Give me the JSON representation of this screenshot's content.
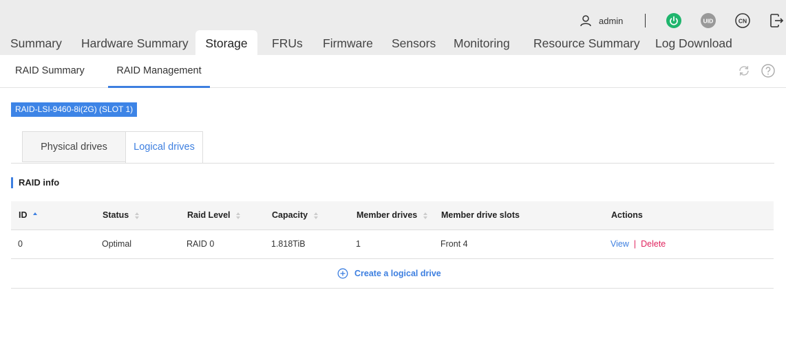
{
  "header": {
    "username": "admin",
    "icons": [
      "user-icon",
      "power-icon",
      "uid-icon",
      "language-icon",
      "logout-icon"
    ],
    "uid_label": "UID",
    "language_label": "CN",
    "colors": {
      "power": "#1fb56d",
      "uid": "#999999"
    }
  },
  "main_tabs": [
    {
      "label": "Summary"
    },
    {
      "label": "Hardware Summary"
    },
    {
      "label": "Storage"
    },
    {
      "label": "FRUs"
    },
    {
      "label": "Firmware"
    },
    {
      "label": "Sensors"
    },
    {
      "label": "Monitoring"
    },
    {
      "label": "Resource Summary"
    },
    {
      "label": "Log Download"
    }
  ],
  "active_main_tab": "Storage",
  "sub_tabs": [
    {
      "label": "RAID Summary"
    },
    {
      "label": "RAID Management"
    }
  ],
  "active_sub_tab": "RAID Management",
  "panel_icons": [
    "refresh-icon",
    "help-icon"
  ],
  "controller": {
    "label": "RAID-LSI-9460-8i(2G) (SLOT 1)"
  },
  "drive_tabs": [
    {
      "label": "Physical drives"
    },
    {
      "label": "Logical drives"
    }
  ],
  "active_drive_tab": "Logical drives",
  "section": {
    "title": "RAID info"
  },
  "table": {
    "columns": [
      {
        "label": "ID",
        "sort": "asc"
      },
      {
        "label": "Status",
        "sort": "none"
      },
      {
        "label": "Raid Level",
        "sort": "none"
      },
      {
        "label": "Capacity",
        "sort": "none"
      },
      {
        "label": "Member drives",
        "sort": "none"
      },
      {
        "label": "Member drive slots"
      },
      {
        "label": "Actions"
      }
    ],
    "rows": [
      {
        "id": "0",
        "status": "Optimal",
        "raid_level": "RAID 0",
        "capacity": "1.818TiB",
        "member_drives": "1",
        "member_drive_slots": "Front 4",
        "actions": {
          "view": "View",
          "separator": "|",
          "delete": "Delete"
        }
      }
    ],
    "create_label": "Create a logical drive"
  },
  "accent_color": "#3d7fe0",
  "danger_color": "#e0245e"
}
